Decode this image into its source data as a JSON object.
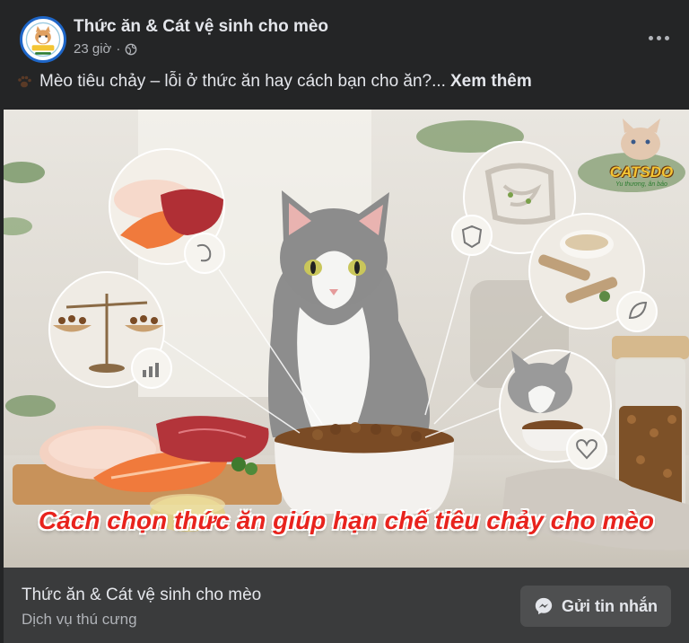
{
  "post": {
    "page_name": "Thức ăn & Cát vệ sinh cho mèo",
    "time": "23 giờ",
    "separator": "·",
    "caption": "Mèo tiêu chảy – lỗi ở thức ăn hay cách bạn cho ăn?...",
    "see_more": "Xem thêm"
  },
  "image": {
    "overlay_title": "Cách chọn thức ăn giúp hạn chế tiêu chảy cho mèo",
    "watermark": "CATSDO",
    "watermark_sub": "Yu thương, ân bảo"
  },
  "footer": {
    "title": "Thức ăn & Cát vệ sinh cho mèo",
    "subtitle": "Dịch vụ thú cưng",
    "message_button": "Gửi tin nhắn"
  },
  "icons": {
    "avatar": "catsdo-logo",
    "audience": "globe-icon",
    "more": "more-options-icon",
    "caption_emoji": "paw-icon",
    "message": "messenger-icon"
  },
  "colors": {
    "background": "#242526",
    "footer": "#3a3b3c",
    "overlay_title": "#e8231d",
    "text_primary": "#e4e6eb",
    "text_secondary": "#b0b3b8"
  }
}
